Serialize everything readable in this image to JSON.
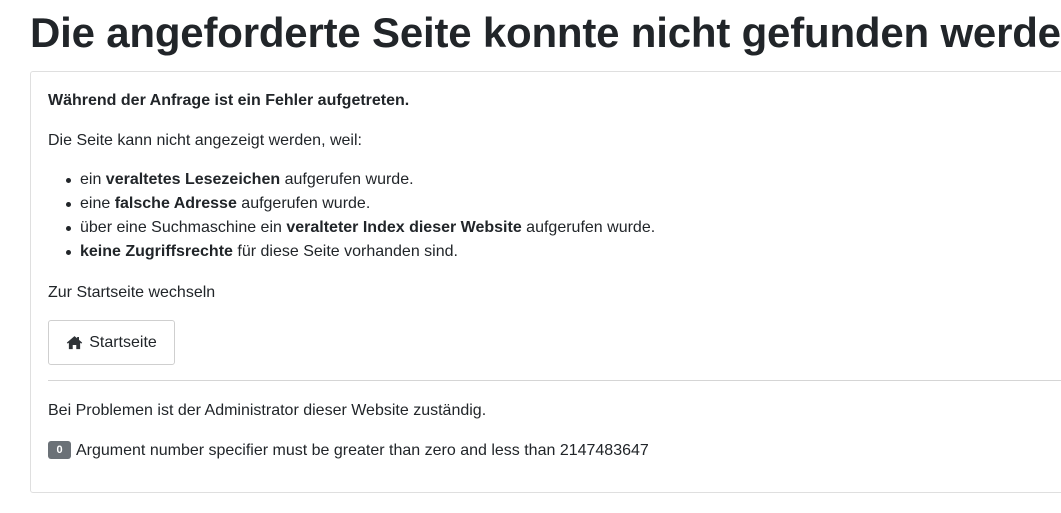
{
  "page": {
    "title": "Die angeforderte Seite konnte nicht gefunden werden."
  },
  "error_panel": {
    "heading": "Während der Anfrage ist ein Fehler aufgetreten.",
    "intro": "Die Seite kann nicht angezeigt werden, weil:",
    "reasons": [
      {
        "before": "ein ",
        "strong": "veraltetes Lesezeichen",
        "after": " aufgerufen wurde."
      },
      {
        "before": "eine ",
        "strong": "falsche Adresse",
        "after": " aufgerufen wurde."
      },
      {
        "before": "über eine Suchmaschine ein ",
        "strong": "veralteter Index dieser Website",
        "after": " aufgerufen wurde."
      },
      {
        "before": "",
        "strong": "keine Zugriffsrechte",
        "after": " für diese Seite vorhanden sind."
      }
    ],
    "home_prompt": "Zur Startseite wechseln",
    "home_button": {
      "label": "Startseite",
      "icon": "home-icon"
    },
    "admin_note": "Bei Problemen ist der Administrator dieser Website zuständig.",
    "error_detail": {
      "badge": "0",
      "message": "Argument number specifier must be greater than zero and less than 2147483647"
    }
  },
  "colors": {
    "text": "#212529",
    "border": "#dfdfdf",
    "badge_bg": "#6b7177"
  }
}
